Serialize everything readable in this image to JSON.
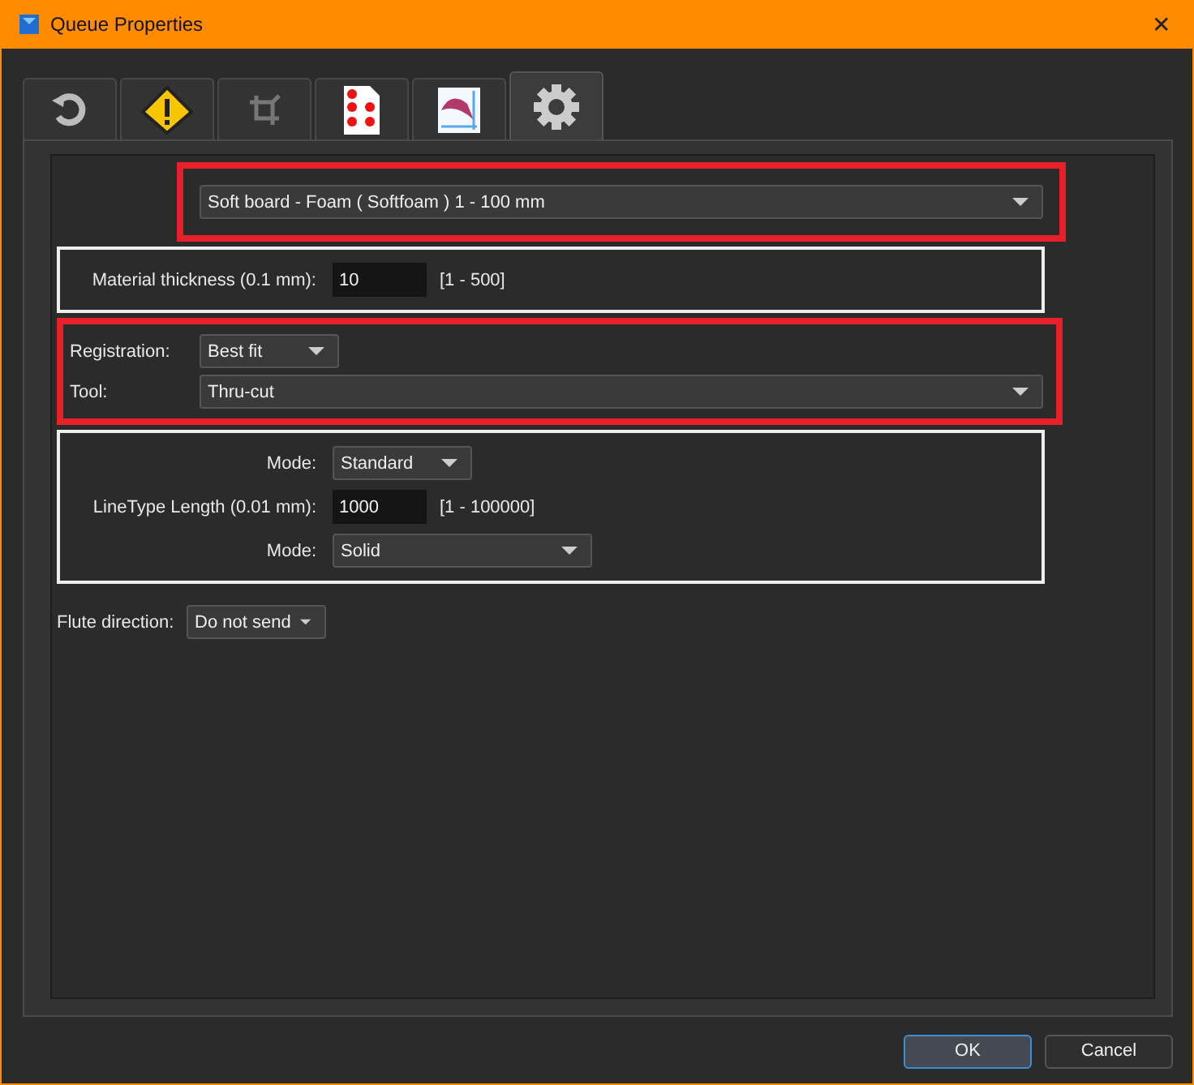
{
  "window": {
    "title": "Queue Properties",
    "close": "✕"
  },
  "tabs": [
    {
      "selected": false
    },
    {
      "selected": false
    },
    {
      "selected": false
    },
    {
      "selected": false
    },
    {
      "selected": false
    },
    {
      "selected": true
    }
  ],
  "sections": [
    {
      "kind": "highlight",
      "rows": [
        {
          "kind": "combo",
          "value": "Soft board - Foam ( Softfoam ) 1 - 100 mm"
        }
      ]
    },
    {
      "kind": "group",
      "rows": [
        {
          "kind": "number",
          "label": "Material thickness (0.1 mm):",
          "value": "10",
          "range": "[1 - 500]"
        }
      ]
    },
    {
      "kind": "highlight",
      "rows": [
        {
          "kind": "dropdown",
          "label": "Registration:",
          "value": "Best fit"
        },
        {
          "kind": "combo",
          "label": "Tool:",
          "value": "Thru-cut"
        }
      ]
    },
    {
      "kind": "group",
      "rows": [
        {
          "kind": "dropdown",
          "label": "Mode:",
          "value": "Standard"
        },
        {
          "kind": "number",
          "label": "LineType Length (0.01 mm):",
          "value": "1000",
          "range": "[1 - 100000]"
        },
        {
          "kind": "dropdown",
          "label": "Mode:",
          "value": "Solid"
        }
      ]
    },
    {
      "kind": "plain",
      "rows": [
        {
          "kind": "dropdown",
          "label": "Flute direction:",
          "value": "Do not send"
        }
      ]
    }
  ],
  "buttons": [
    {
      "label": "OK",
      "default": true
    },
    {
      "label": "Cancel",
      "default": false
    }
  ]
}
